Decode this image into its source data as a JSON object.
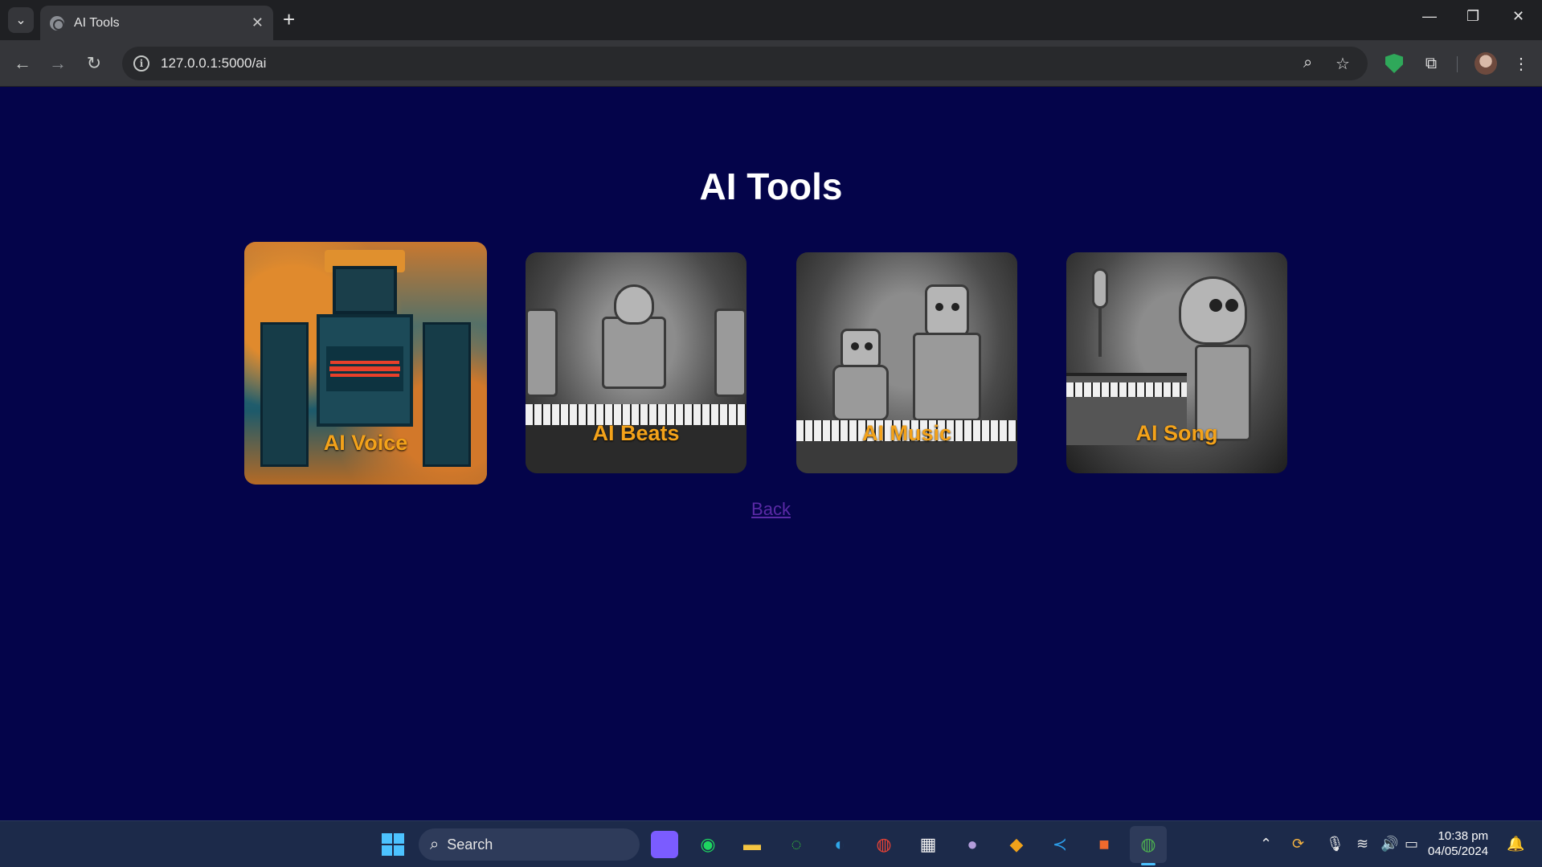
{
  "browser": {
    "tab_title": "AI Tools",
    "tab_close": "✕",
    "new_tab": "+",
    "url": "127.0.0.1:5000/ai",
    "window_controls": [
      "—",
      "❐",
      "✕"
    ],
    "nav_icons": [
      "back-arrow-icon",
      "forward-arrow-icon",
      "reload-icon"
    ]
  },
  "page": {
    "title": "AI Tools",
    "cards": [
      {
        "label": "AI Voice"
      },
      {
        "label": "AI Beats"
      },
      {
        "label": "AI Music"
      },
      {
        "label": "AI Song"
      }
    ],
    "back_link": "Back",
    "colors": {
      "background": "#04044a",
      "card_label": "#f3a21a",
      "title": "#ffffff",
      "back_link": "#5a2aa6"
    }
  },
  "taskbar": {
    "search_placeholder": "Search",
    "time": "10:38 pm",
    "date": "04/05/2024"
  }
}
